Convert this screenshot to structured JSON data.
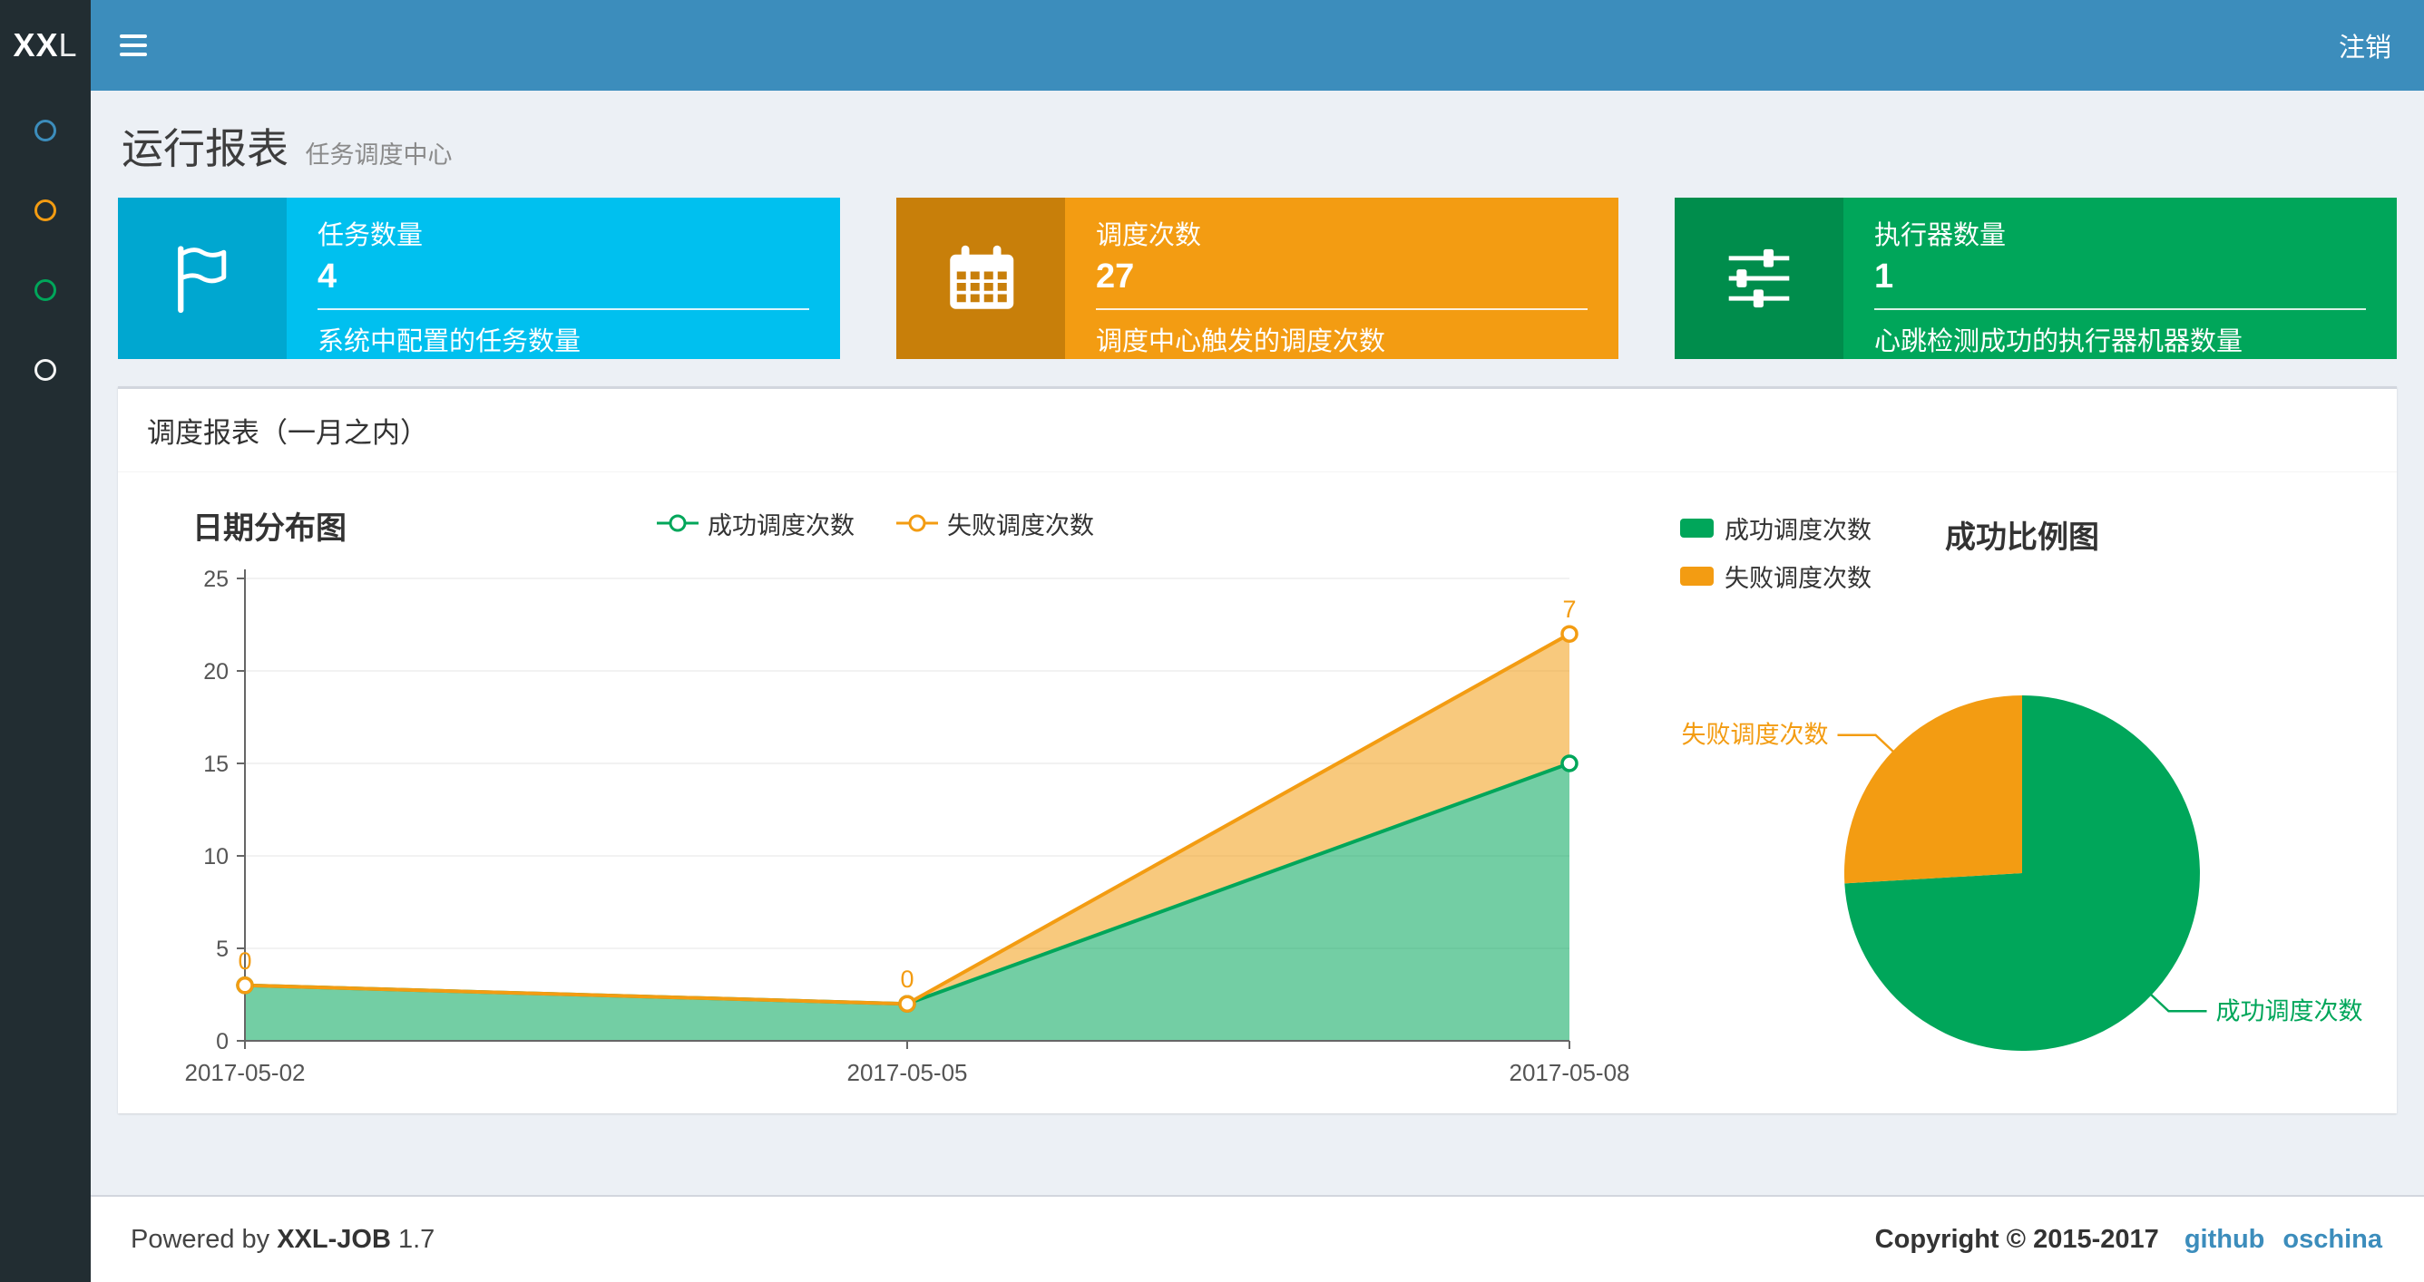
{
  "navbar": {
    "logo_bold": "XX",
    "logo_light": "L",
    "logout_label": "注销"
  },
  "sidebar": {
    "items": [
      {
        "name": "sidebar-item-1",
        "color": "#3c8dbc"
      },
      {
        "name": "sidebar-item-2",
        "color": "#f39c12"
      },
      {
        "name": "sidebar-item-3",
        "color": "#00a65a"
      },
      {
        "name": "sidebar-item-4",
        "color": "#f5f5f5"
      }
    ]
  },
  "page": {
    "title": "运行报表",
    "subtitle": "任务调度中心"
  },
  "info_boxes": [
    {
      "title": "任务数量",
      "value": "4",
      "desc": "系统中配置的任务数量",
      "bg": "#00c0ef",
      "icon_bg": "#00a7d0",
      "icon": "flag-icon"
    },
    {
      "title": "调度次数",
      "value": "27",
      "desc": "调度中心触发的调度次数",
      "bg": "#f39c12",
      "icon_bg": "#c87f0a",
      "icon": "calendar-icon"
    },
    {
      "title": "执行器数量",
      "value": "1",
      "desc": "心跳检测成功的执行器机器数量",
      "bg": "#00a65a",
      "icon_bg": "#008d4c",
      "icon": "sliders-icon"
    }
  ],
  "panel": {
    "title": "调度报表（一月之内）"
  },
  "chart_data": [
    {
      "type": "area",
      "title": "日期分布图",
      "stacked": true,
      "x": [
        "2017-05-02",
        "2017-05-05",
        "2017-05-08"
      ],
      "series": [
        {
          "name": "成功调度次数",
          "values": [
            3,
            2,
            15
          ],
          "color": "#00a65a",
          "fill": "rgba(0,166,90,0.55)",
          "labels": false
        },
        {
          "name": "失败调度次数",
          "values": [
            0,
            0,
            7
          ],
          "color": "#f39c12",
          "fill": "rgba(243,156,18,0.55)",
          "labels": true
        }
      ],
      "ylim": [
        0,
        25
      ],
      "yticks": [
        0,
        5,
        10,
        15,
        20,
        25
      ],
      "grid": true,
      "legend_position": "top-center"
    },
    {
      "type": "pie",
      "title": "成功比例图",
      "slices": [
        {
          "name": "成功调度次数",
          "value": 20,
          "color": "#00a65a"
        },
        {
          "name": "失败调度次数",
          "value": 7,
          "color": "#f39c12"
        }
      ],
      "start_angle_deg": 0,
      "clockwise": true,
      "legend_position": "top-left"
    }
  ],
  "footer": {
    "powered_prefix": "Powered by",
    "product": "XXL-JOB",
    "version": "1.7",
    "copyright": "Copyright © 2015-2017",
    "links": [
      {
        "label": "github"
      },
      {
        "label": "oschina"
      }
    ],
    "link_color": "#3c8dbc"
  }
}
